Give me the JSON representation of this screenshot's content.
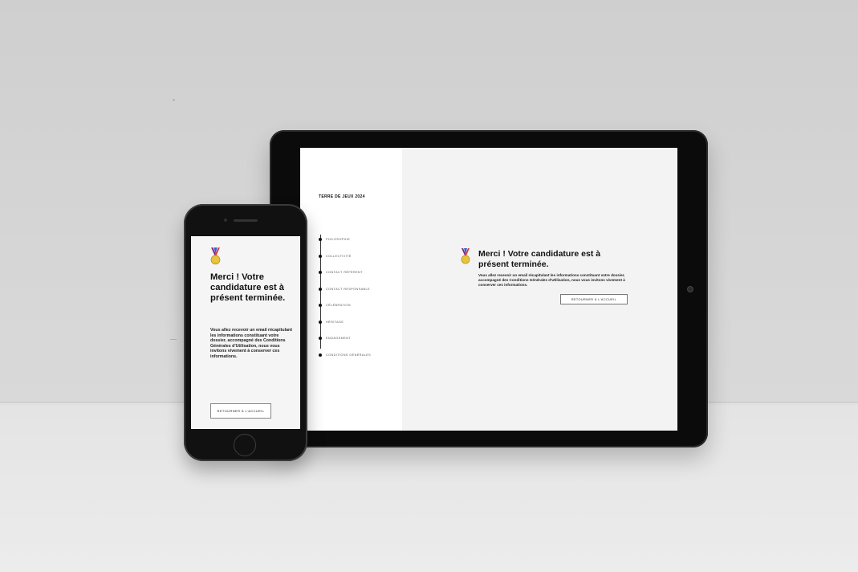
{
  "tablet": {
    "brand": "TERRE DE JEUX 2024",
    "nav_items": [
      {
        "label": "PHILOSOPHIE"
      },
      {
        "label": "COLLECTIVITÉ"
      },
      {
        "label": "CONTACT RÉFÉRENT"
      },
      {
        "label": "CONTACT RESPONSABLE"
      },
      {
        "label": "CÉLÉBRATION"
      },
      {
        "label": "HÉRITAGE"
      },
      {
        "label": "ENGAGEMENT"
      },
      {
        "label": "CONDITIONS GÉNÉRALES"
      }
    ],
    "title": "Merci ! Votre candidature est à présent terminée.",
    "body": "Vous allez recevoir un email récapitulant les informations constituant votre dossier, accompagné des Conditions Générales d'Utilisation, nous vous invitons vivement à conserver ces informations.",
    "button": "RETOURNER À L'ACCUEIL"
  },
  "phone": {
    "title": "Merci ! Votre candidature est à présent terminée.",
    "body": "Vous allez recevoir un email récapitulant les informations constituant votre dossier, accompagné des Conditions Générales d'Utilisation, nous vous invitons vivement à conserver ces informations.",
    "button": "RETOURNER À L'ACCUEIL"
  },
  "icons": {
    "medal": "medal-icon"
  },
  "colors": {
    "medal_gold": "#e8c43a",
    "ribbon": "#7b2a7f",
    "ribbon_red": "#d43b3b"
  }
}
